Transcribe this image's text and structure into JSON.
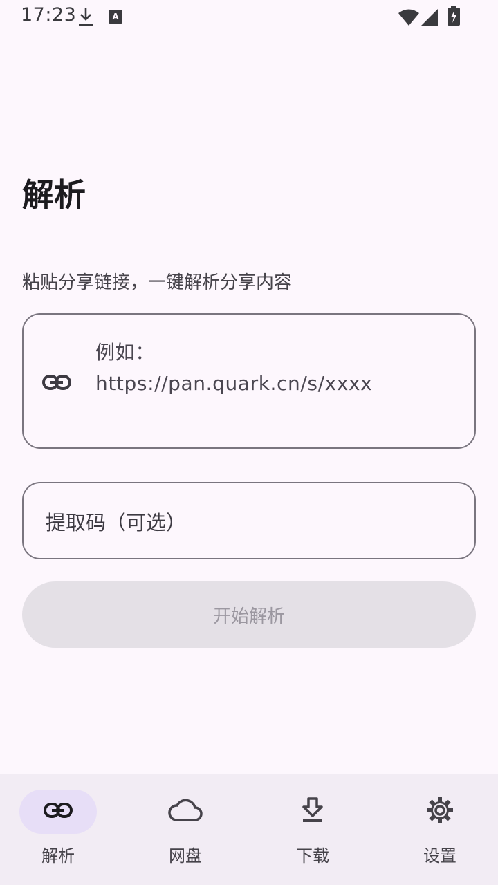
{
  "status_bar": {
    "time": "17:23",
    "icons": [
      "download-icon",
      "keyboard-a-icon",
      "wifi-icon",
      "signal-icon",
      "battery-charging-icon"
    ]
  },
  "page": {
    "title": "解析",
    "subtitle": "粘贴分享链接，一键解析分享内容"
  },
  "link_input": {
    "icon": "link-icon",
    "placeholder": "例如：\nhttps://pan.quark.cn/s/xxxx",
    "value": ""
  },
  "code_input": {
    "placeholder": "提取码（可选）",
    "value": ""
  },
  "start_button": {
    "label": "开始解析",
    "enabled": false
  },
  "bottom_nav": {
    "items": [
      {
        "label": "解析",
        "icon": "link-icon",
        "active": true
      },
      {
        "label": "网盘",
        "icon": "cloud-icon",
        "active": false
      },
      {
        "label": "下载",
        "icon": "download-icon",
        "active": false
      },
      {
        "label": "设置",
        "icon": "gear-icon",
        "active": false
      }
    ]
  },
  "colors": {
    "background": "#fdf7fd",
    "nav_background": "#f2ecf4",
    "active_pill": "#e7def7",
    "outline": "#7a757f",
    "button_disabled_bg": "#e4e0e6",
    "button_disabled_text": "#9b97a0"
  }
}
